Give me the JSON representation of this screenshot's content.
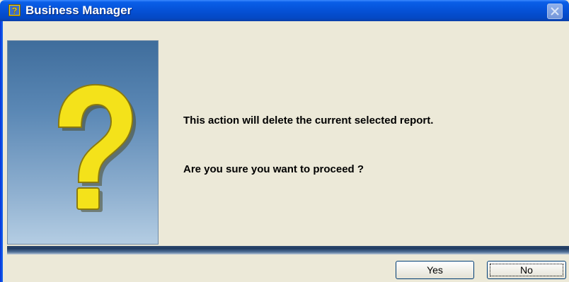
{
  "window": {
    "title": "Business Manager",
    "title_icon": "question-icon",
    "close_icon": "close-icon"
  },
  "dialog": {
    "side_image": "question-mark-icon",
    "message_line_1": "This action will delete the current selected report.",
    "message_line_2": "Are you sure you want to proceed ?"
  },
  "buttons": {
    "yes_label": "Yes",
    "no_label": "No"
  },
  "colors": {
    "titlebar": "#0551d6",
    "dialog_bg": "#ece9d8",
    "question_mark": "#f4e21a"
  }
}
